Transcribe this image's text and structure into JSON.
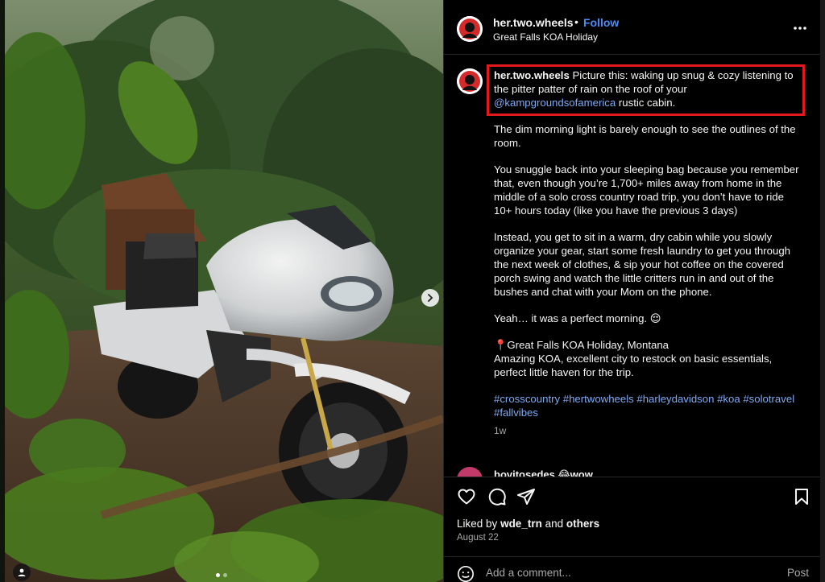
{
  "post": {
    "username": "her.two.wheels",
    "dot": "•",
    "follow_label": "Follow",
    "location": "Great Falls KOA Holiday"
  },
  "caption": {
    "username": "her.two.wheels",
    "text_1": "Picture this: waking up snug & cozy listening to the pitter patter of rain on the roof of your",
    "mention": "@kampgroundsofamerica",
    "text_2": "rustic cabin.",
    "para_2": "The dim morning light is barely enough to see the outlines of the room.",
    "para_3": "You snuggle back into your sleeping bag because you remember that, even though you’re 1,700+ miles away from home in the middle of a solo cross country road trip, you don’t have to ride 10+ hours today (like you have the previous 3 days)",
    "para_4": "Instead, you get to sit in a warm, dry cabin while you slowly organize your gear, start some fresh laundry to get you through the next week of clothes, & sip your hot coffee on the covered porch swing and watch the little critters run in and out of the bushes and chat with your Mom on the phone.",
    "para_5": "Yeah… it was a perfect morning. 😌",
    "para_6_line1": "📍Great Falls KOA Holiday, Montana",
    "para_6_line2": "Amazing KOA, excellent city to restock on basic essentials, perfect little haven for the trip.",
    "hashtags": "#crosscountry #hertwowheels #harleydavidson #koa #solotravel #fallvibes",
    "time": "1w"
  },
  "comment_peek": {
    "text": "bovitosedes 😂wow"
  },
  "engagement": {
    "liked_by_prefix": "Liked by",
    "liked_by_user": "wde_trn",
    "liked_by_and": "and",
    "liked_by_others": "others",
    "date": "August 22"
  },
  "add_comment": {
    "placeholder": "Add a comment...",
    "post_label": "Post"
  },
  "icons": {
    "more": "more-horizontal-icon",
    "like": "heart-icon",
    "comment": "comment-bubble-icon",
    "share": "paper-plane-icon",
    "save": "bookmark-icon",
    "emoji": "smiley-icon",
    "next": "chevron-right-icon",
    "tag": "user-tag-icon"
  },
  "colors": {
    "accent": "#4a8df8",
    "link": "#7daaf5",
    "highlight_box": "#e2191d",
    "background": "#000000"
  }
}
